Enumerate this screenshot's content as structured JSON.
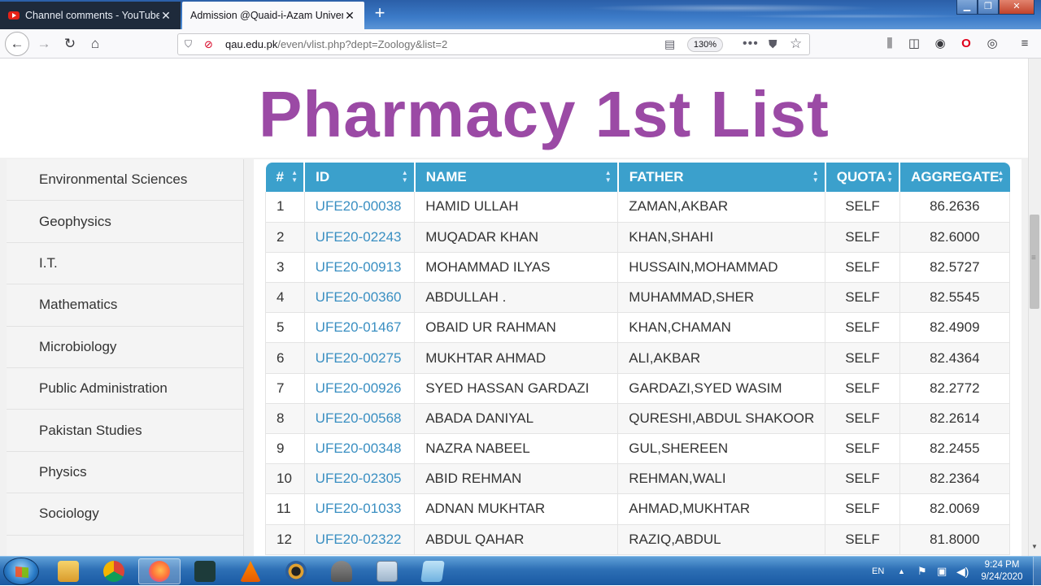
{
  "browser": {
    "tabs": [
      {
        "title": "Channel comments - YouTube S",
        "active": false
      },
      {
        "title": "Admission @Quaid-i-Azam Univers",
        "active": true
      }
    ],
    "url_host": "qau.edu.pk",
    "url_path": "/even/vlist.php?dept=Zoology&list=2",
    "zoom": "130%"
  },
  "page": {
    "title": "Pharmacy 1st List",
    "title_color": "#9b4aa5",
    "accent_color": "#3ba0cc",
    "link_color": "#3a8fc2"
  },
  "sidebar": {
    "items": [
      "Environmental Sciences",
      "Geophysics",
      "I.T.",
      "Mathematics",
      "Microbiology",
      "Public Administration",
      "Pakistan Studies",
      "Physics",
      "Sociology"
    ]
  },
  "table": {
    "headers": [
      "#",
      "ID",
      "NAME",
      "FATHER",
      "QUOTA",
      "AGGREGATE"
    ],
    "rows": [
      [
        "1",
        "UFE20-00038",
        "HAMID ULLAH",
        "ZAMAN,AKBAR",
        "SELF",
        "86.2636"
      ],
      [
        "2",
        "UFE20-02243",
        "MUQADAR KHAN",
        "KHAN,SHAHI",
        "SELF",
        "82.6000"
      ],
      [
        "3",
        "UFE20-00913",
        "MOHAMMAD ILYAS",
        "HUSSAIN,MOHAMMAD",
        "SELF",
        "82.5727"
      ],
      [
        "4",
        "UFE20-00360",
        "ABDULLAH .",
        "MUHAMMAD,SHER",
        "SELF",
        "82.5545"
      ],
      [
        "5",
        "UFE20-01467",
        "OBAID UR RAHMAN",
        "KHAN,CHAMAN",
        "SELF",
        "82.4909"
      ],
      [
        "6",
        "UFE20-00275",
        "MUKHTAR AHMAD",
        "ALI,AKBAR",
        "SELF",
        "82.4364"
      ],
      [
        "7",
        "UFE20-00926",
        "SYED HASSAN GARDAZI",
        "GARDAZI,SYED WASIM",
        "SELF",
        "82.2772"
      ],
      [
        "8",
        "UFE20-00568",
        "ABADA DANIYAL",
        "QURESHI,ABDUL SHAKOOR",
        "SELF",
        "82.2614"
      ],
      [
        "9",
        "UFE20-00348",
        "NAZRA NABEEL",
        "GUL,SHEREEN",
        "SELF",
        "82.2455"
      ],
      [
        "10",
        "UFE20-02305",
        "ABID REHMAN",
        "REHMAN,WALI",
        "SELF",
        "82.2364"
      ],
      [
        "11",
        "UFE20-01033",
        "ADNAN MUKHTAR",
        "AHMAD,MUKHTAR",
        "SELF",
        "82.0069"
      ],
      [
        "12",
        "UFE20-02322",
        "ABDUL QAHAR",
        "RAZIQ,ABDUL",
        "SELF",
        "81.8000"
      ]
    ]
  },
  "taskbar": {
    "apps": [
      "explorer-icon",
      "chrome-icon",
      "firefox-icon",
      "filmora-icon",
      "vlc-icon",
      "media-icon",
      "app-icon",
      "calculator-icon",
      "notepad-icon"
    ],
    "language": "EN",
    "time": "9:24 PM",
    "date": "9/24/2020"
  }
}
